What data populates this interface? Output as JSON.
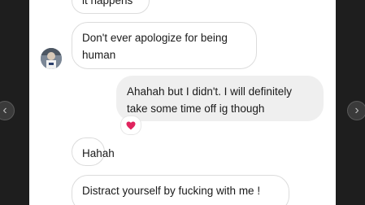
{
  "messages": [
    {
      "id": "m0",
      "text": "it happens",
      "from": "them"
    },
    {
      "id": "m1",
      "text": "Don't ever apologize for being human",
      "from": "them"
    },
    {
      "id": "m2",
      "text": "Ahahah but I didn't. I will definitely take some time off ig though",
      "from": "me"
    },
    {
      "id": "m3",
      "text": "Hahah",
      "from": "them"
    },
    {
      "id": "m4",
      "text": "Distract yourself by fucking with me !",
      "from": "them"
    }
  ],
  "reaction": {
    "emoji": "heart-icon",
    "color": "#e0245e"
  },
  "nav": {
    "prev_icon": "chevron-left-icon",
    "next_icon": "chevron-right-icon"
  },
  "colors": {
    "incoming_bubble": "#ffffff",
    "outgoing_bubble": "#efefef",
    "background": "#1e1e1e"
  }
}
